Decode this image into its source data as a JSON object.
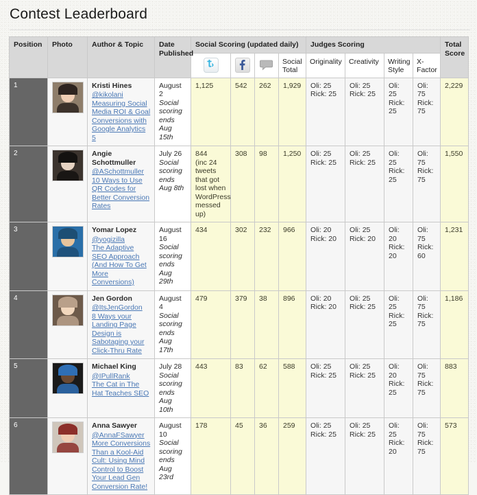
{
  "page": {
    "title": "Contest Leaderboard"
  },
  "table": {
    "headers": {
      "position": "Position",
      "photo": "Photo",
      "author_topic": "Author & Topic",
      "date_published": "Date Published",
      "social_scoring": "Social Scoring (updated daily)",
      "judges_scoring": "Judges Scoring",
      "total_score": "Total Score",
      "twitter_icon": "twitter-icon",
      "facebook_icon": "facebook-icon",
      "comments_icon": "comment-bubble-icon",
      "social_total": "Social Total",
      "originality": "Originality",
      "creativity": "Creativity",
      "writing_style": "Writing Style",
      "x_factor": "X-Factor"
    },
    "rows": [
      {
        "position": "1",
        "author": "Kristi Hines",
        "handle": "@kikolani",
        "topic": "Measuring Social Media ROI & Goal Conversions with Google Analytics 5",
        "date": "August 2",
        "date_note": "Social scoring ends Aug 15th",
        "twitter": "1,125",
        "twitter_note": "",
        "facebook": "542",
        "comments": "262",
        "social_total": "1,929",
        "originality": {
          "oli": "Oli: 25",
          "rick": "Rick: 25"
        },
        "creativity": {
          "oli": "Oli: 25",
          "rick": "Rick: 25"
        },
        "writing_style": {
          "oli": "Oli: 25",
          "rick": "Rick: 25"
        },
        "x_factor": {
          "oli": "Oli: 75",
          "rick": "Rick: 75"
        },
        "total": "2,229"
      },
      {
        "position": "2",
        "author": "Angie Schottmuller",
        "handle": "@ASchottmuller",
        "topic": "10 Ways to Use QR Codes for Better Conversion Rates",
        "date": "July 26",
        "date_note": "Social scoring ends Aug 8th",
        "twitter": "844",
        "twitter_note": "(inc 24 tweets that got lost when WordPress messed up)",
        "facebook": "308",
        "comments": "98",
        "social_total": "1,250",
        "originality": {
          "oli": "Oli: 25",
          "rick": "Rick: 25"
        },
        "creativity": {
          "oli": "Oli: 25",
          "rick": "Rick: 25"
        },
        "writing_style": {
          "oli": "Oli: 25",
          "rick": "Rick: 25"
        },
        "x_factor": {
          "oli": "Oli: 75",
          "rick": "Rick: 75"
        },
        "total": "1,550"
      },
      {
        "position": "3",
        "author": "Yomar Lopez",
        "handle": "@yogizilla",
        "topic": "The Adaptive SEO Approach (And How To Get More Conversions)",
        "date": "August 16",
        "date_note": "Social scoring ends Aug 29th",
        "twitter": "434",
        "twitter_note": "",
        "facebook": "302",
        "comments": "232",
        "social_total": "966",
        "originality": {
          "oli": "Oli: 20",
          "rick": "Rick: 20"
        },
        "creativity": {
          "oli": "Oli: 25",
          "rick": "Rick: 20"
        },
        "writing_style": {
          "oli": "Oli: 20",
          "rick": "Rick: 20"
        },
        "x_factor": {
          "oli": "Oli: 75",
          "rick": "Rick: 60"
        },
        "total": "1,231"
      },
      {
        "position": "4",
        "author": "Jen Gordon",
        "handle": "@ItsJenGordon",
        "topic": "8 Ways your Landing Page Design is Sabotaging your Click-Thru Rate",
        "date": "August 4",
        "date_note": "Social scoring ends Aug 17th",
        "twitter": "479",
        "twitter_note": "",
        "facebook": "379",
        "comments": "38",
        "social_total": "896",
        "originality": {
          "oli": "Oli: 20",
          "rick": "Rick: 20"
        },
        "creativity": {
          "oli": "Oli: 25",
          "rick": "Rick: 25"
        },
        "writing_style": {
          "oli": "Oli: 25",
          "rick": "Rick: 25"
        },
        "x_factor": {
          "oli": "Oli: 75",
          "rick": "Rick: 75"
        },
        "total": "1,186"
      },
      {
        "position": "5",
        "author": "Michael King",
        "handle": "@IPullRank",
        "topic": "The Cat in The Hat Teaches SEO",
        "date": "July 28",
        "date_note": "Social scoring ends Aug 10th",
        "twitter": "443",
        "twitter_note": "",
        "facebook": "83",
        "comments": "62",
        "social_total": "588",
        "originality": {
          "oli": "Oli: 25",
          "rick": "Rick: 25"
        },
        "creativity": {
          "oli": "Oli: 25",
          "rick": "Rick: 25"
        },
        "writing_style": {
          "oli": "Oli: 20",
          "rick": "Rick: 25"
        },
        "x_factor": {
          "oli": "Oli: 75",
          "rick": "Rick: 75"
        },
        "total": "883"
      },
      {
        "position": "6",
        "author": "Anna Sawyer",
        "handle": "@AnnaFSawyer",
        "topic": "More Conversions Than a Kool-Aid Cult: Using Mind Control to Boost Your Lead Gen Conversion Rate!",
        "date": "August 10",
        "date_note": "Social scoring ends Aug 23rd",
        "twitter": "178",
        "twitter_note": "",
        "facebook": "45",
        "comments": "36",
        "social_total": "259",
        "originality": {
          "oli": "Oli: 25",
          "rick": "Rick: 25"
        },
        "creativity": {
          "oli": "Oli: 25",
          "rick": "Rick: 25"
        },
        "writing_style": {
          "oli": "Oli: 25",
          "rick": "Rick: 20"
        },
        "x_factor": {
          "oli": "Oli: 75",
          "rick": "Rick: 75"
        },
        "total": "573"
      }
    ]
  },
  "colors": {
    "header_bg": "#d8d8d8",
    "position_bg": "#666666",
    "social_bg": "#fafad7",
    "link": "#4a78b5",
    "twitter_blue": "#33b3e0",
    "facebook_blue": "#3b5998"
  }
}
